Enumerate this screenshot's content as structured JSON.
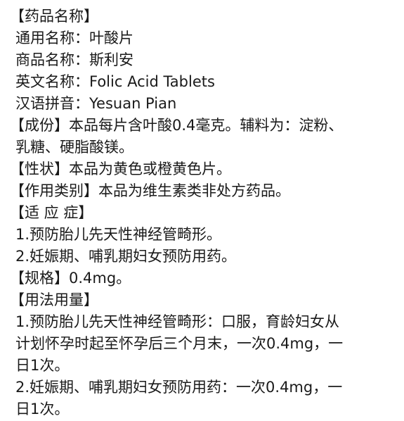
{
  "lines": [
    "【药品名称】",
    "通用名称：叶酸片",
    "商品名称：斯利安",
    "英文名称：Folic Acid Tablets",
    "汉语拼音：Yesuan Pian",
    "【成份】本品每片含叶酸0.4毫克。辅料为：淀粉、",
    "乳糖、硬脂酸镁。",
    "【性状】本品为黄色或橙黄色片。",
    "【作用类别】本品为维生素类非处方药品。",
    "【适 应 症】",
    "1.预防胎儿先天性神经管畸形。",
    "2.妊娠期、哺乳期妇女预防用药。",
    "【规格】0.4mg。",
    "【用法用量】",
    "1.预防胎儿先天性神经管畸形：口服，育龄妇女从",
    "计划怀孕时起至怀孕后三个月末，一次0.4mg，一",
    "日1次。",
    "2.妊娠期、哺乳期妇女预防用药：一次0.4mg，一",
    "日1次。"
  ]
}
